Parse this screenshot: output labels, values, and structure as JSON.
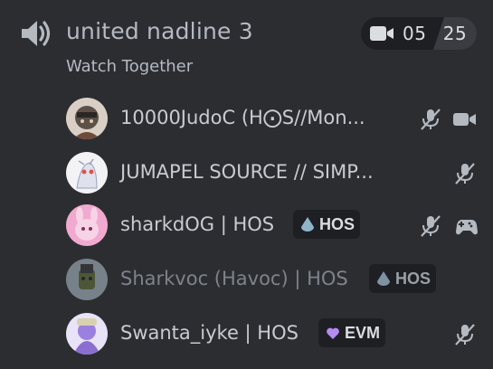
{
  "channel": {
    "name": "united nadline 3",
    "activity": "Watch Together",
    "icon": "speaker-icon",
    "video_count": "05",
    "user_limit": "25"
  },
  "users": [
    {
      "name": "10000JudoC (H⨀S//Mon...",
      "tag": "",
      "status_icons": [
        "mic-muted-icon",
        "video-icon"
      ]
    },
    {
      "name": "JUMAPEL SOURCE // SIMP...",
      "tag": "",
      "status_icons": [
        "mic-muted-icon"
      ]
    },
    {
      "name": "sharkdOG | HOS",
      "tag": "HOS",
      "tag_icon": "hos-drop-icon",
      "status_icons": [
        "mic-muted-icon",
        "gamepad-icon"
      ]
    },
    {
      "name": "Sharkvoc (Havoc) | HOS",
      "tag": "HOS",
      "tag_icon": "hos-drop-icon",
      "status_icons": []
    },
    {
      "name": "Swanta_iyke | HOS",
      "tag": "EVM",
      "tag_icon": "heart-icon",
      "status_icons": [
        "mic-muted-icon"
      ]
    }
  ],
  "colors": {
    "background": "#2b2d31",
    "text": "#b5bac1",
    "pill": "#1e1f22",
    "evm_heart": "#b58bf2",
    "hos_drop": "#8fb3c9"
  }
}
